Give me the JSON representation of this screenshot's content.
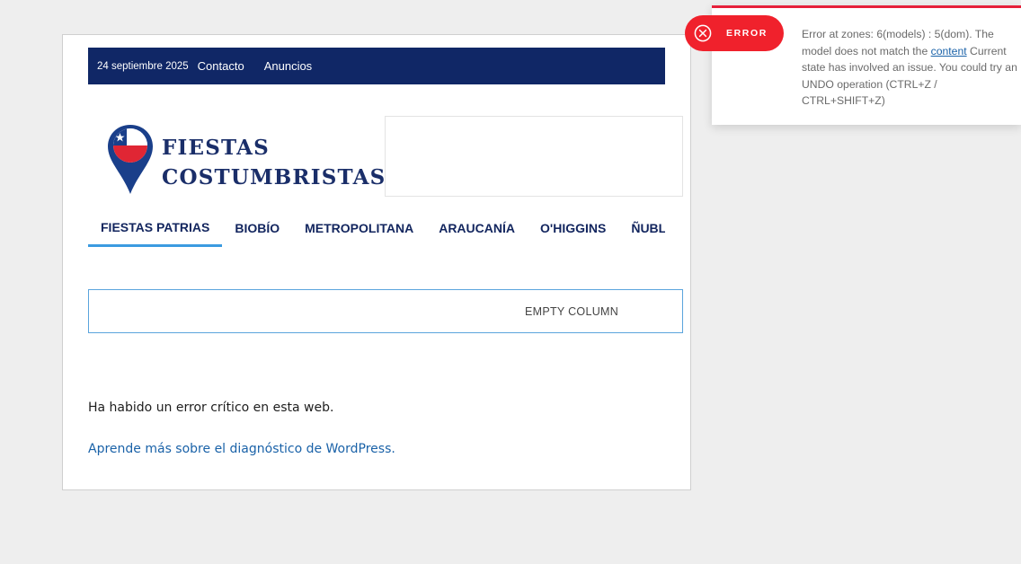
{
  "topbar": {
    "date": "24 septiembre 2025",
    "links": [
      "Contacto",
      "Anuncios"
    ]
  },
  "logo": {
    "line1": "FIESTAS",
    "line2": "COSTUMBRISTAS",
    "icon": "chile-flag-map-pin-icon"
  },
  "nav": {
    "items": [
      "FIESTAS PATRIAS",
      "BIOBÍO",
      "METROPOLITANA",
      "ARAUCANÍA",
      "O'HIGGINS",
      "ÑUBLE"
    ],
    "active_index": 0
  },
  "empty_column": {
    "label": "EMPTY COLUMN"
  },
  "error_page": {
    "message": "Ha habido un error crítico en esta web.",
    "link_text": "Aprende más sobre el diagnóstico de WordPress."
  },
  "toast": {
    "badge_label": "ERROR",
    "icon": "close-circle-icon",
    "text_before": "Error at zones: 6(models) : 5(dom). The model does not match the ",
    "link_text": "content",
    "text_after": " Current state has involved an issue. You could try an UNDO operation (CTRL+Z / CTRL+SHIFT+Z)"
  },
  "colors": {
    "topbar_bg": "#102766",
    "nav_text": "#12255e",
    "nav_active_underline": "#3b9be0",
    "badge_bg": "#f0212c",
    "link": "#1a62a8"
  }
}
